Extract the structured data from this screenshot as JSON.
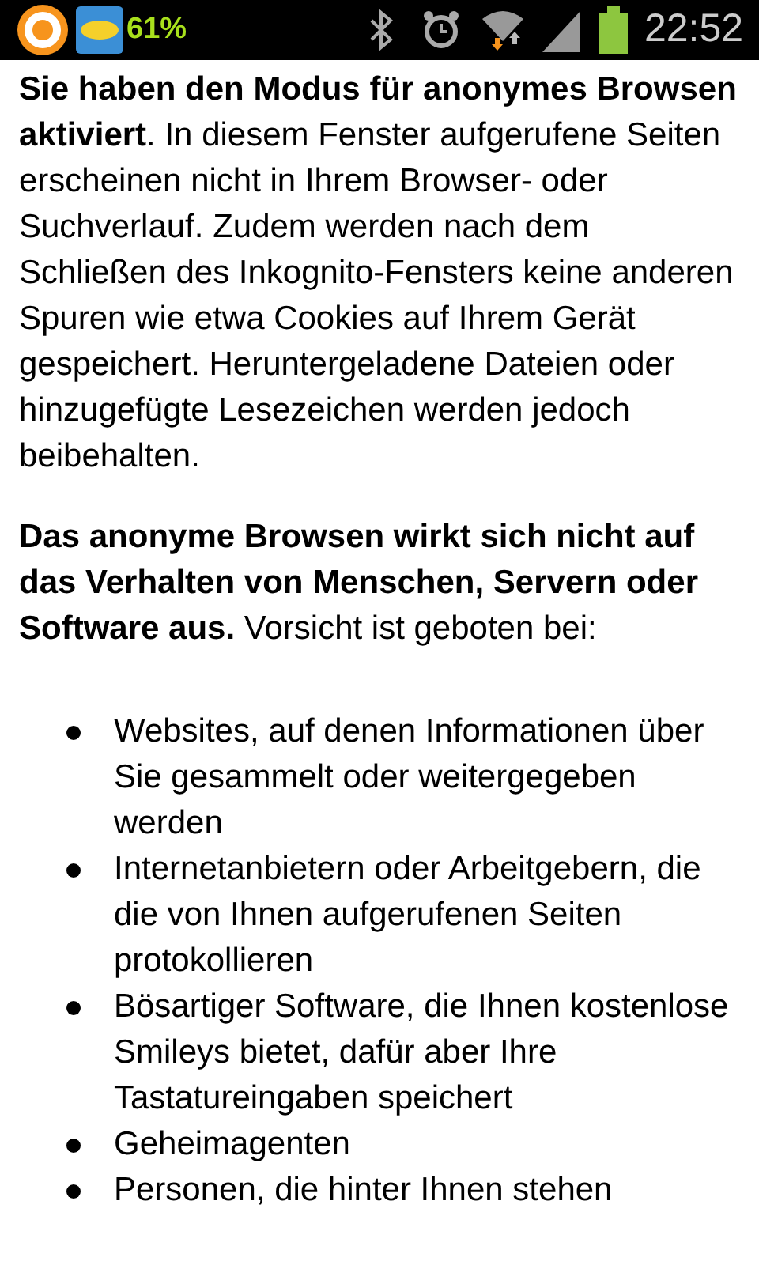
{
  "status_bar": {
    "notification_percent": "61%",
    "time": "22:52"
  },
  "paragraphs": [
    "**Sie haben den Modus für anonymes Browsen aktiviert**. In diesem Fenster aufgerufene Seiten erscheinen nicht in Ihrem Browser- oder Suchverlauf. Zudem werden nach dem Schließen des Inkognito-Fensters keine anderen Spuren wie etwa Cookies auf Ihrem Gerät gespeichert. Heruntergeladene Dateien oder hinzugefügte Lesezeichen werden jedoch beibehalten.",
    "**Das anonyme Browsen wirkt sich nicht auf das Verhalten von Menschen, Servern oder Software aus.** Vorsicht ist geboten bei:"
  ],
  "list_items": [
    "Websites, auf denen Informationen über Sie gesammelt oder weitergegeben werden",
    "Internetanbietern oder Arbeitgebern, die die von Ihnen aufgerufenen Seiten protokollieren",
    "Bösartiger Software, die Ihnen kostenlose Smileys bietet, dafür aber Ihre Tastatureingaben speichert",
    "Geheimagenten",
    "Personen, die hinter Ihnen stehen"
  ]
}
